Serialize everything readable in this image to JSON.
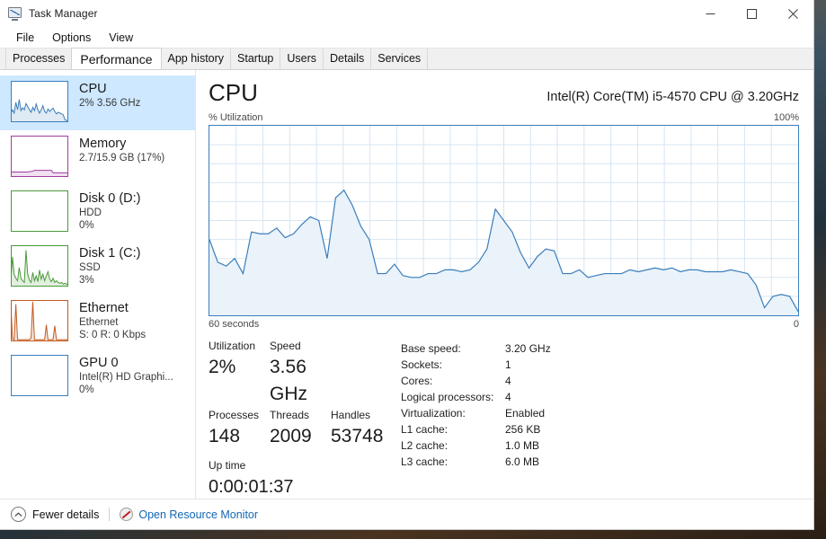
{
  "window": {
    "title": "Task Manager",
    "app_icon": "task-manager-icon",
    "controls": {
      "minimize": "—",
      "maximize": "□",
      "close": "✕"
    }
  },
  "menu": {
    "items": [
      "File",
      "Options",
      "View"
    ]
  },
  "tabs": {
    "items": [
      "Processes",
      "Performance",
      "App history",
      "Startup",
      "Users",
      "Details",
      "Services"
    ],
    "active": "Performance"
  },
  "sidebar": {
    "items": [
      {
        "title": "CPU",
        "sub1": "2%  3.56 GHz",
        "sub2": "",
        "color": "#3a7ebb",
        "selected": true
      },
      {
        "title": "Memory",
        "sub1": "2.7/15.9 GB (17%)",
        "sub2": "",
        "color": "#a23ca2",
        "selected": false
      },
      {
        "title": "Disk 0 (D:)",
        "sub1": "HDD",
        "sub2": "0%",
        "color": "#4a9a3a",
        "selected": false
      },
      {
        "title": "Disk 1 (C:)",
        "sub1": "SSD",
        "sub2": "3%",
        "color": "#4a9a3a",
        "selected": false
      },
      {
        "title": "Ethernet",
        "sub1": "Ethernet",
        "sub2": "S: 0 R: 0 Kbps",
        "color": "#c25a1e",
        "selected": false
      },
      {
        "title": "GPU 0",
        "sub1": "Intel(R) HD Graphi...",
        "sub2": "0%",
        "color": "#3a7ebb",
        "selected": false
      }
    ]
  },
  "main": {
    "heading": "CPU",
    "model": "Intel(R) Core(TM) i5-4570 CPU @ 3.20GHz",
    "graph_top_left_label": "% Utilization",
    "graph_top_right_label": "100%",
    "graph_bottom_left_label": "60 seconds",
    "graph_bottom_right_label": "0",
    "graph_line_color": "#3a7ebb",
    "graph_fill_color": "#eaf2fa"
  },
  "stats": {
    "utilization_label": "Utilization",
    "utilization_value": "2%",
    "speed_label": "Speed",
    "speed_value": "3.56 GHz",
    "processes_label": "Processes",
    "processes_value": "148",
    "threads_label": "Threads",
    "threads_value": "2009",
    "handles_label": "Handles",
    "handles_value": "53748",
    "uptime_label": "Up time",
    "uptime_value": "0:00:01:37"
  },
  "specs": [
    {
      "label": "Base speed:",
      "value": "3.20 GHz"
    },
    {
      "label": "Sockets:",
      "value": "1"
    },
    {
      "label": "Cores:",
      "value": "4"
    },
    {
      "label": "Logical processors:",
      "value": "4"
    },
    {
      "label": "Virtualization:",
      "value": "Enabled"
    },
    {
      "label": "L1 cache:",
      "value": "256 KB"
    },
    {
      "label": "L2 cache:",
      "value": "1.0 MB"
    },
    {
      "label": "L3 cache:",
      "value": "6.0 MB"
    }
  ],
  "footer": {
    "fewer_details": "Fewer details",
    "fewer_details_icon": "chevron-up-circle-icon",
    "resource_monitor": "Open Resource Monitor",
    "resource_monitor_icon": "resource-monitor-icon",
    "link_color": "#1267b5"
  },
  "chart_data": {
    "type": "area",
    "title": "CPU % Utilization",
    "xlabel": "60 seconds",
    "ylabel": "% Utilization",
    "ylim": [
      0,
      100
    ],
    "xlim": [
      60,
      0
    ],
    "grid": true,
    "grid_cols": 22,
    "grid_rows": 10,
    "series": [
      {
        "name": "CPU utilization",
        "values": [
          40,
          28,
          26,
          30,
          22,
          44,
          43,
          43,
          46,
          41,
          43,
          48,
          52,
          50,
          30,
          62,
          66,
          58,
          47,
          40,
          22,
          22,
          27,
          21,
          20,
          20,
          22,
          22,
          24,
          24,
          23,
          24,
          28,
          35,
          56,
          50,
          44,
          33,
          25,
          31,
          35,
          34,
          22,
          22,
          24,
          20,
          21,
          22,
          22,
          22,
          24,
          23,
          24,
          25,
          24,
          25,
          23,
          24,
          24,
          23,
          23,
          23,
          24,
          23,
          22,
          16,
          4,
          10,
          11,
          10,
          2
        ]
      }
    ]
  },
  "sidebar_charts": [
    {
      "name": "cpu-mini-chart",
      "type": "area",
      "values": [
        20,
        30,
        22,
        48,
        30,
        55,
        28,
        35,
        30,
        45,
        38,
        30,
        24,
        36,
        28,
        44,
        30,
        22,
        30,
        40,
        26,
        22,
        32,
        26,
        30,
        34,
        26,
        20,
        24,
        22,
        20,
        18,
        6,
        4,
        4
      ]
    },
    {
      "name": "memory-mini-chart",
      "type": "area",
      "values": [
        12,
        12,
        12,
        12,
        12,
        12,
        12,
        12,
        12,
        12,
        12,
        13,
        13,
        14,
        16,
        16,
        16,
        16,
        16,
        16,
        16,
        16,
        16,
        16,
        16,
        10,
        10,
        10,
        10,
        10,
        10,
        10,
        10,
        10,
        10
      ]
    },
    {
      "name": "disk0-mini-chart",
      "type": "area",
      "values": [
        3,
        0,
        0,
        0,
        0,
        0,
        0,
        0,
        0,
        0,
        0,
        0,
        0,
        0,
        0,
        0,
        0,
        0,
        0,
        0,
        0,
        0,
        0,
        0,
        0,
        0,
        0,
        0,
        0,
        0,
        0,
        0,
        0,
        0,
        0
      ]
    },
    {
      "name": "disk1-mini-chart",
      "type": "area",
      "values": [
        10,
        72,
        30,
        20,
        14,
        46,
        20,
        14,
        10,
        88,
        30,
        16,
        10,
        34,
        14,
        26,
        12,
        40,
        18,
        30,
        14,
        26,
        36,
        18,
        12,
        20,
        10,
        14,
        10,
        8,
        10,
        6,
        8,
        6,
        4
      ]
    },
    {
      "name": "ethernet-mini-chart",
      "type": "area",
      "values": [
        92,
        6,
        4,
        90,
        4,
        4,
        4,
        4,
        4,
        4,
        4,
        4,
        8,
        96,
        4,
        4,
        4,
        4,
        4,
        4,
        4,
        40,
        4,
        4,
        4,
        4,
        38,
        4,
        4,
        4,
        4,
        4,
        4,
        4,
        4
      ]
    },
    {
      "name": "gpu-mini-chart",
      "type": "area",
      "values": [
        0,
        0,
        0,
        0,
        0,
        0,
        0,
        0,
        0,
        0,
        0,
        0,
        0,
        0,
        0,
        0,
        0,
        0,
        0,
        0,
        0,
        0,
        0,
        0,
        0,
        0,
        0,
        0,
        0,
        0,
        0,
        0,
        0,
        0,
        0
      ]
    }
  ]
}
